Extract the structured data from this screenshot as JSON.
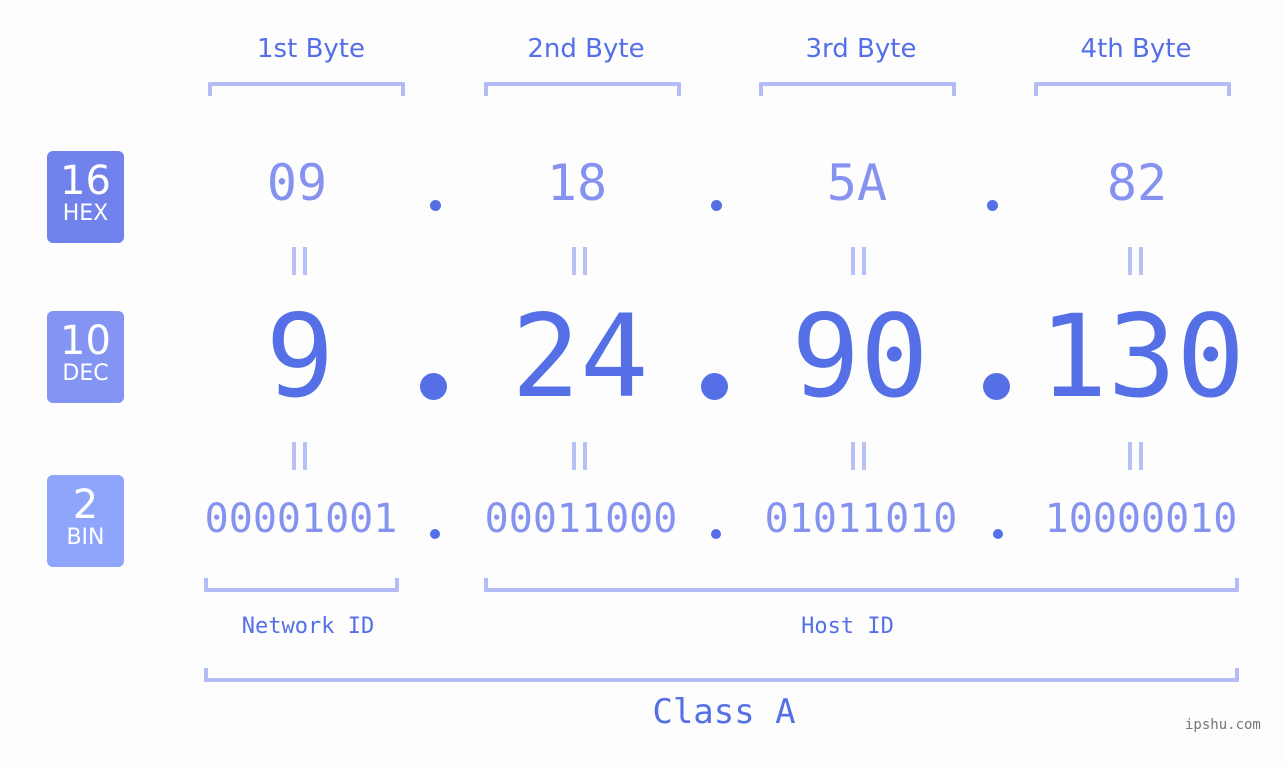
{
  "byte_headers": [
    "1st Byte",
    "2nd Byte",
    "3rd Byte",
    "4th Byte"
  ],
  "badges": {
    "hex": {
      "base": "16",
      "label": "HEX",
      "color": "#7282ec"
    },
    "dec": {
      "base": "10",
      "label": "DEC",
      "color": "#8494f2"
    },
    "bin": {
      "base": "2",
      "label": "BIN",
      "color": "#8da6fb"
    }
  },
  "ip": {
    "hex": [
      "09",
      "18",
      "5A",
      "82"
    ],
    "dec": [
      "9",
      "24",
      "90",
      "130"
    ],
    "bin": [
      "00001001",
      "00011000",
      "01011010",
      "10000010"
    ]
  },
  "network_id_label": "Network ID",
  "host_id_label": "Host ID",
  "class_label": "Class A",
  "watermark": "ipshu.com",
  "colors": {
    "accent": "#5570e6",
    "light_accent": "#8592ef",
    "bracket": "#b3bcf5",
    "background": "#fcfdfc"
  }
}
